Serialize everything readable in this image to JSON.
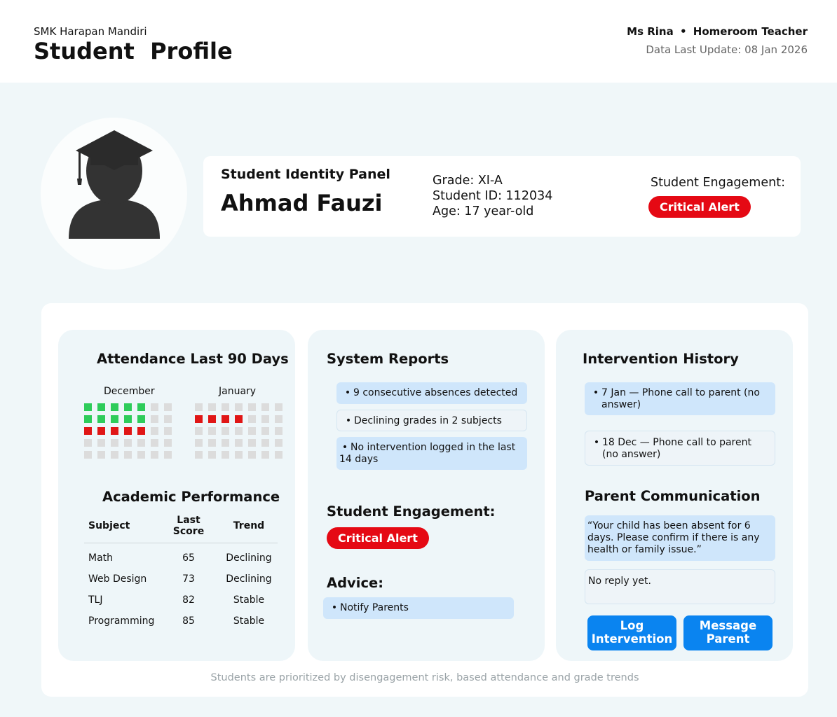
{
  "header": {
    "school": "SMK Harapan Mandiri",
    "title": "Student  Profile",
    "teacher_name": "Ms Rina",
    "separator": "•",
    "teacher_role": "Homeroom Teacher",
    "last_update": "Data Last Update: 08 Jan 2026"
  },
  "identity": {
    "panel_label": "Student Identity Panel",
    "name": "Ahmad Fauzi",
    "grade": "Grade: XI-A",
    "student_id": "Student ID: 112034",
    "age": "Age: 17 year-old",
    "engagement_label": "Student Engagement:",
    "engagement_status": "Critical Alert"
  },
  "attendance": {
    "title": "Attendance Last 90 Days",
    "months": [
      {
        "label": "December",
        "rows": [
          [
            "green",
            "green",
            "green",
            "green",
            "green",
            "gray",
            "gray"
          ],
          [
            "green",
            "green",
            "green",
            "green",
            "green",
            "gray",
            "gray"
          ],
          [
            "red",
            "red",
            "red",
            "red",
            "red",
            "gray",
            "gray"
          ],
          [
            "gray",
            "gray",
            "gray",
            "gray",
            "gray",
            "gray",
            "gray"
          ],
          [
            "gray",
            "gray",
            "gray",
            "gray",
            "gray",
            "gray",
            "gray"
          ]
        ]
      },
      {
        "label": "January",
        "rows": [
          [
            "gray",
            "gray",
            "gray",
            "gray",
            "gray",
            "gray",
            "gray"
          ],
          [
            "red",
            "red",
            "red",
            "red",
            "gray",
            "gray",
            "gray"
          ],
          [
            "gray",
            "gray",
            "gray",
            "gray",
            "gray",
            "gray",
            "gray"
          ],
          [
            "gray",
            "gray",
            "gray",
            "gray",
            "gray",
            "gray",
            "gray"
          ],
          [
            "gray",
            "gray",
            "gray",
            "gray",
            "gray",
            "gray",
            "gray"
          ]
        ]
      }
    ]
  },
  "academic": {
    "title": "Academic Performance",
    "headers": [
      "Subject",
      "Last Score",
      "Trend"
    ],
    "rows": [
      [
        "Math",
        "65",
        "Declining"
      ],
      [
        "Web Design",
        "73",
        "Declining"
      ],
      [
        "TLJ",
        "82",
        "Stable"
      ],
      [
        "Programming",
        "85",
        "Stable"
      ]
    ]
  },
  "system_reports": {
    "title": "System Reports",
    "items": [
      "9 consecutive absences detected",
      "Declining grades in 2 subjects",
      "No intervention logged in the last 14 days"
    ],
    "engagement_label": "Student Engagement:",
    "engagement_status": "Critical Alert",
    "advice_title": "Advice:",
    "advice_items": [
      "Notify Parents"
    ]
  },
  "intervention": {
    "title": "Intervention History",
    "items": [
      "7 Jan — Phone call to parent (no answer)",
      "18 Dec — Phone call to parent (no answer)"
    ],
    "parent_title": "Parent Communication",
    "message": "“Your child has been absent for 6 days.   Please confirm if there is any health or family issue.”",
    "reply": "No reply yet.",
    "log_button": "Log Intervention",
    "message_button": "Message Parent"
  },
  "footnote": "Students are prioritized by disengagement risk, based attendance and grade trends",
  "colors": {
    "critical": "#e50914",
    "primary_button": "#0a84f0",
    "present": "#2ecc5a",
    "absent": "#e01616",
    "no_data": "#dcdcdc",
    "report_box": "#cfe6fb"
  }
}
